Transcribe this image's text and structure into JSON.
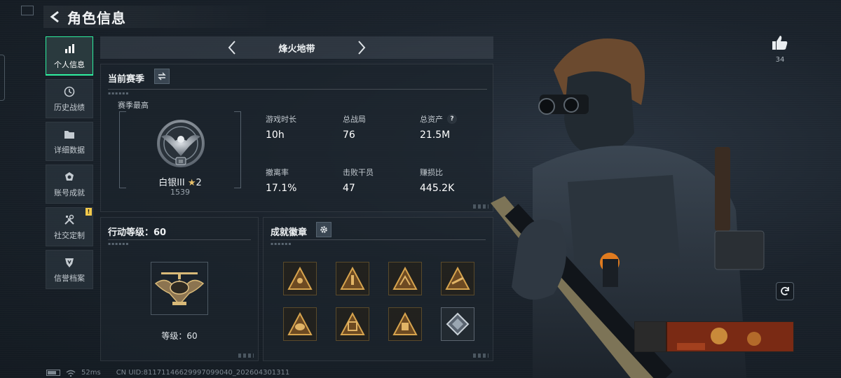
{
  "header": {
    "title": "角色信息"
  },
  "sidebar": {
    "items": [
      {
        "label": "个人信息",
        "icon": "bar-chart-icon",
        "active": true
      },
      {
        "label": "历史战绩",
        "icon": "clock-icon"
      },
      {
        "label": "详细数据",
        "icon": "folder-icon"
      },
      {
        "label": "账号成就",
        "icon": "medal-icon"
      },
      {
        "label": "社交定制",
        "icon": "tools-icon",
        "badge": "!"
      },
      {
        "label": "信誉档案",
        "icon": "shield-icon"
      }
    ]
  },
  "map_selector": {
    "current": "烽火地带"
  },
  "season": {
    "title": "当前赛季",
    "best_label": "赛季最高",
    "rank_name": "白银III",
    "rank_stars": "2",
    "rank_score": "1539",
    "stats": [
      {
        "label": "游戏时长",
        "value": "10h"
      },
      {
        "label": "总战局",
        "value": "76"
      },
      {
        "label": "总资产",
        "value": "21.5M",
        "help": "?"
      },
      {
        "label": "撤离率",
        "value": "17.1%"
      },
      {
        "label": "击败干员",
        "value": "47"
      },
      {
        "label": "赚损比",
        "value": "445.2K"
      }
    ]
  },
  "action_level": {
    "title": "行动等级：60",
    "level_text": "等级：60"
  },
  "achievements": {
    "title": "成就徽章",
    "badges": [
      "achievement-badge-1",
      "achievement-badge-2",
      "achievement-badge-3",
      "achievement-badge-4",
      "achievement-badge-5",
      "achievement-badge-6",
      "achievement-badge-7",
      "achievement-badge-8"
    ]
  },
  "social": {
    "like_count": "34"
  },
  "footer": {
    "latency": "52ms",
    "uid": "CN UID:8117114662999709904​0_202604301311"
  },
  "colors": {
    "accent": "#2ff0a0",
    "badge_gold": "#c9a15a",
    "warning": "#f2c94c"
  }
}
